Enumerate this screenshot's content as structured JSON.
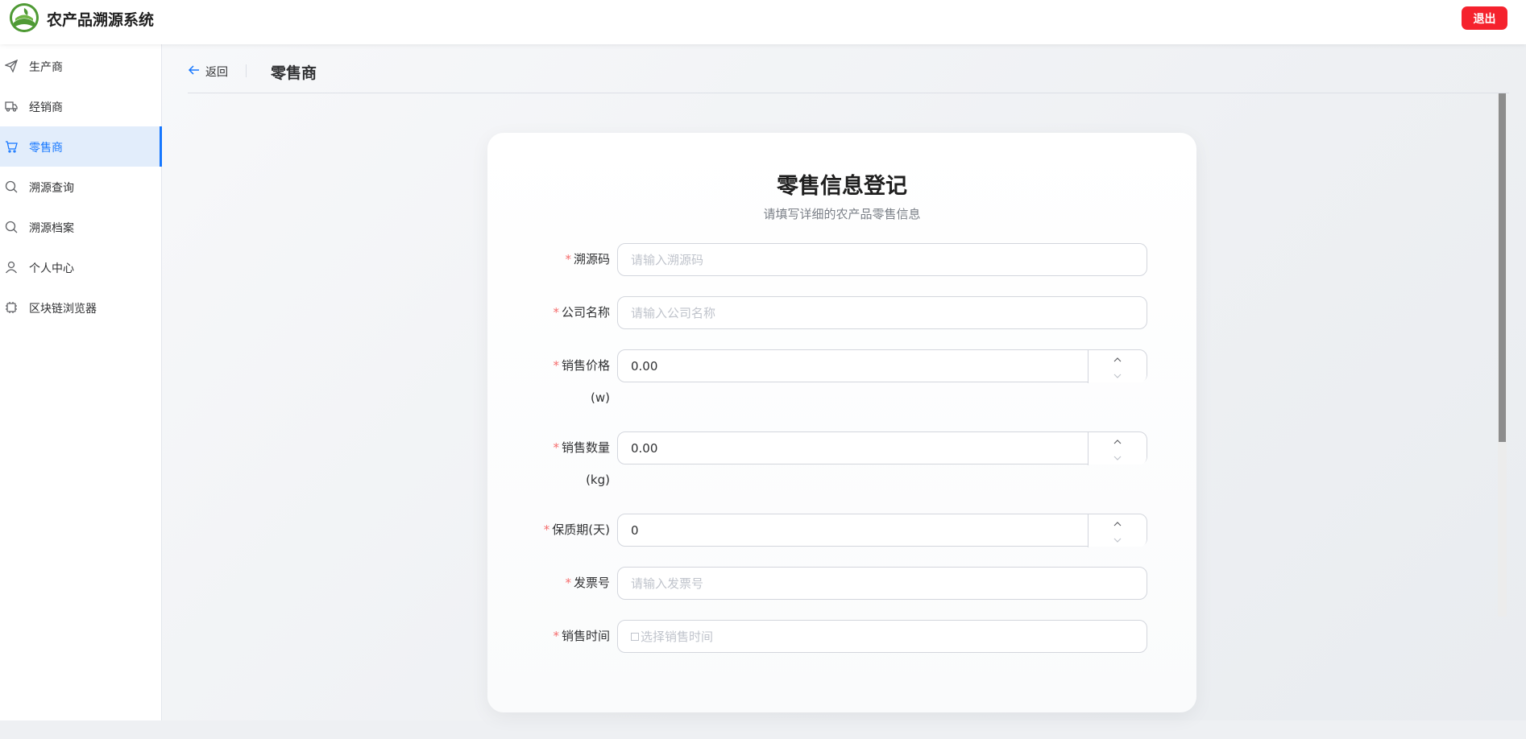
{
  "header": {
    "app_title": "农产品溯源系统",
    "logout_label": "退出",
    "logout_color": "#f5222d"
  },
  "sidebar": {
    "items": [
      {
        "label": "生产商",
        "icon": "paper-plane-icon",
        "active": false
      },
      {
        "label": "经销商",
        "icon": "truck-icon",
        "active": false
      },
      {
        "label": "零售商",
        "icon": "shopping-cart-icon",
        "active": true
      },
      {
        "label": "溯源查询",
        "icon": "search-icon",
        "active": false
      },
      {
        "label": "溯源档案",
        "icon": "search-icon",
        "active": false
      },
      {
        "label": "个人中心",
        "icon": "user-icon",
        "active": false
      },
      {
        "label": "区块链浏览器",
        "icon": "chip-icon",
        "active": false
      }
    ],
    "accent_color": "#1677ff"
  },
  "page_header": {
    "back_label": "返回",
    "title": "零售商"
  },
  "card": {
    "title": "零售信息登记",
    "subtitle": "请填写详细的农产品零售信息"
  },
  "form": {
    "required_mark": "*",
    "fields": [
      {
        "label": "溯源码",
        "placeholder": "请输入溯源码",
        "value": ""
      },
      {
        "label": "公司名称",
        "placeholder": "请输入公司名称",
        "value": ""
      },
      {
        "label": "销售价格",
        "unit": "(w)",
        "value": "0.00"
      },
      {
        "label": "销售数量",
        "unit": "(kg)",
        "value": "0.00"
      },
      {
        "label": "保质期(天)",
        "value": "0"
      },
      {
        "label": "发票号",
        "placeholder": "请输入发票号",
        "value": ""
      },
      {
        "label": "销售时间",
        "placeholder": "选择销售时间",
        "value": ""
      }
    ]
  }
}
